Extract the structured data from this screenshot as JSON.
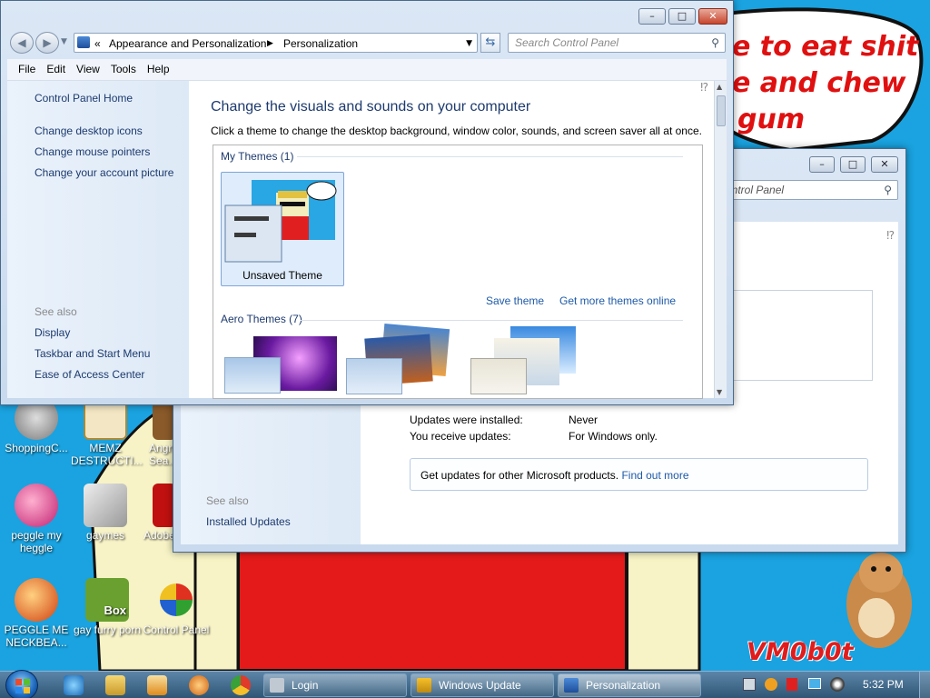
{
  "desktop": {
    "wallpaper_text": [
      "e to eat shit",
      "e and chew",
      "gum"
    ],
    "watermark": "VM0b0t",
    "icons": [
      {
        "label": "ShoppingC..."
      },
      {
        "label": "MEMZ DESTRUCTI..."
      },
      {
        "label": "Angr Sea..."
      },
      {
        "label": "peggle my heggle"
      },
      {
        "label": "gaymes"
      },
      {
        "label": "Adobe"
      },
      {
        "label": "PEGGLE ME NECKBEA..."
      },
      {
        "label": "gay furry porn"
      },
      {
        "label": "Control Panel"
      }
    ],
    "box_icon_text": "Box"
  },
  "personalization": {
    "breadcrumb": [
      "Appearance and Personalization",
      "Personalization"
    ],
    "breadcrumb_chevron": "«",
    "search_placeholder": "Search Control Panel",
    "menu": [
      "File",
      "Edit",
      "View",
      "Tools",
      "Help"
    ],
    "sidebar": {
      "home": "Control Panel Home",
      "links": [
        "Change desktop icons",
        "Change mouse pointers",
        "Change your account picture"
      ],
      "see_also": "See also",
      "see_also_links": [
        "Display",
        "Taskbar and Start Menu",
        "Ease of Access Center"
      ]
    },
    "main": {
      "title": "Change the visuals and sounds on your computer",
      "subtitle": "Click a theme to change the desktop background, window color, sounds, and screen saver all at once.",
      "my_themes": "My Themes (1)",
      "unsaved_theme": "Unsaved Theme",
      "save_theme": "Save theme",
      "get_more": "Get more themes online",
      "aero_themes": "Aero Themes (7)"
    }
  },
  "windows_update": {
    "search_placeholder": "ontrol Panel",
    "rows": [
      {
        "label": "Updates were installed:",
        "value": "Never"
      },
      {
        "label": "You receive updates:",
        "value": "For Windows only."
      }
    ],
    "info_text": "Get updates for other Microsoft products.",
    "info_link": "Find out more",
    "see_also": "See also",
    "installed_updates": "Installed Updates"
  },
  "taskbar": {
    "buttons": [
      {
        "label": "Login"
      },
      {
        "label": "Windows Update"
      },
      {
        "label": "Personalization"
      }
    ],
    "clock": "5:32 PM"
  },
  "colors": {
    "desktop": "#1aa3e0",
    "link": "#1e5aa8",
    "heading": "#1d3a6e"
  }
}
